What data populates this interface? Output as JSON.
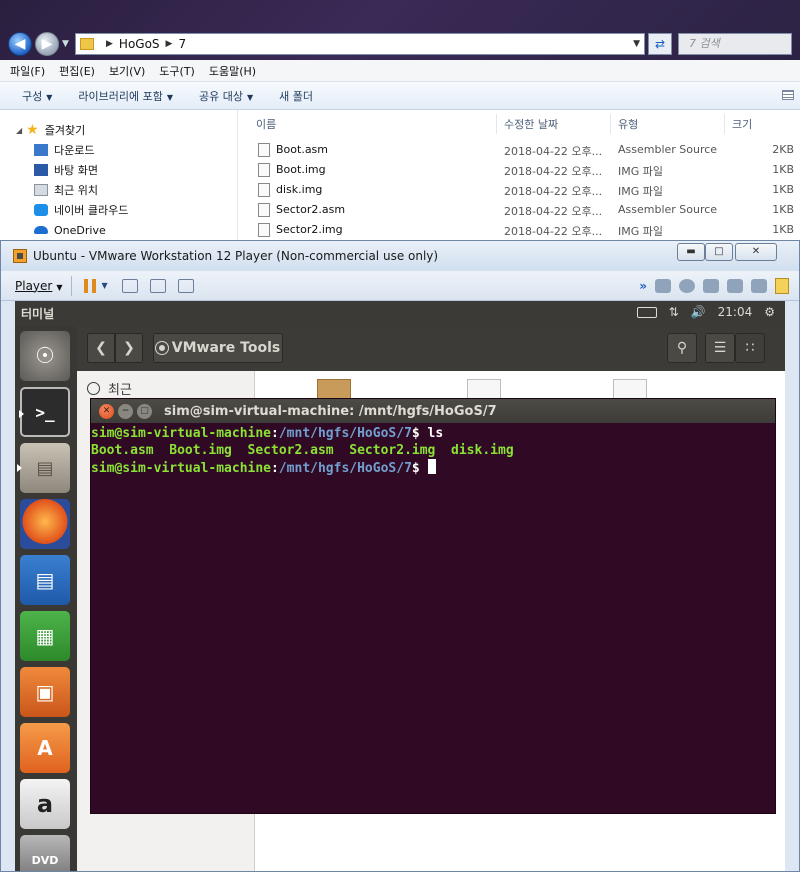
{
  "explorer": {
    "address": {
      "segments": [
        "HoGoS",
        "7"
      ]
    },
    "search_placeholder": "7 검색",
    "menu": [
      "파일(F)",
      "편집(E)",
      "보기(V)",
      "도구(T)",
      "도움말(H)"
    ],
    "toolbar": [
      "구성",
      "라이브러리에 포함",
      "공유 대상",
      "새 폴더"
    ],
    "nav": {
      "favorites": "즐겨찾기",
      "items": [
        "다운로드",
        "바탕 화면",
        "최근 위치",
        "네이버 클라우드",
        "OneDrive"
      ]
    },
    "columns": {
      "name": "이름",
      "date": "수정한 날짜",
      "type": "유형",
      "size": "크기"
    },
    "files": [
      {
        "name": "Boot.asm",
        "date": "2018-04-22 오후...",
        "type": "Assembler Source",
        "size": "2KB"
      },
      {
        "name": "Boot.img",
        "date": "2018-04-22 오후...",
        "type": "IMG 파일",
        "size": "1KB"
      },
      {
        "name": "disk.img",
        "date": "2018-04-22 오후...",
        "type": "IMG 파일",
        "size": "1KB"
      },
      {
        "name": "Sector2.asm",
        "date": "2018-04-22 오후...",
        "type": "Assembler Source",
        "size": "1KB"
      },
      {
        "name": "Sector2.img",
        "date": "2018-04-22 오후...",
        "type": "IMG 파일",
        "size": "1KB"
      }
    ]
  },
  "vmware": {
    "title": "Ubuntu - VMware Workstation 12 Player (Non-commercial use only)",
    "player_menu": "Player",
    "accent": "#e08a1e"
  },
  "ubuntu": {
    "panel_title": "터미널",
    "clock": "21:04",
    "nautilus": {
      "path_label": "VMware Tools",
      "sidebar_recent": "최근"
    },
    "terminal": {
      "title": "sim@sim-virtual-machine: /mnt/hgfs/HoGoS/7",
      "prompt_user": "sim@sim-virtual-machine",
      "prompt_sep": ":",
      "prompt_path": "/mnt/hgfs/HoGoS/7",
      "prompt_sigil": "$",
      "command": " ls",
      "output": "Boot.asm  Boot.img  Sector2.asm  Sector2.img  disk.img",
      "colors": {
        "bg": "#300a24",
        "user": "#8ae234",
        "path": "#729fcf"
      }
    }
  }
}
